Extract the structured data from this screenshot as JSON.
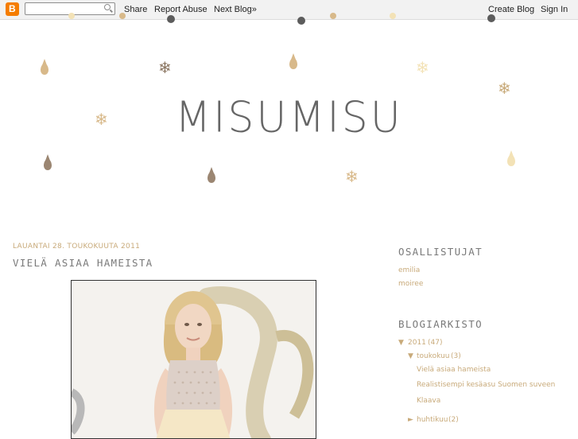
{
  "navbar": {
    "logo_letter": "B",
    "share": "Share",
    "report": "Report Abuse",
    "next": "Next Blog»",
    "create": "Create Blog",
    "signin": "Sign In"
  },
  "header": {
    "title": "MISUMISU"
  },
  "post": {
    "date": "LAUANTAI 28. TOUKOKUUTA 2011",
    "title": "VIELÄ ASIAA HAMEISTA"
  },
  "sidebar": {
    "contributors_heading": "OSALLISTUJAT",
    "contributors": [
      "emilia",
      "moiree"
    ],
    "archive_heading": "BLOGIARKISTO",
    "archive": {
      "year": "2011",
      "year_count": "(47)",
      "month": "toukokuu",
      "month_count": "(3)",
      "posts": [
        "Vielä asiaa hameista",
        "Realistisempi kesäasu Suomen suveen",
        "Klaava"
      ],
      "next_month": "huhtikuu",
      "next_month_count": "(2)"
    }
  },
  "colors": {
    "accent": "#c8aa7a",
    "orange_logo": "#f57d00",
    "drop_brown": "#9b8672",
    "drop_tan": "#d8b98a",
    "drop_gray": "#5c5c5c",
    "drop_pale": "#f3e2b6"
  },
  "icons": [
    "blogger-logo-icon",
    "search-icon",
    "snowflake-icon",
    "raindrop-icon",
    "triangle-down-icon",
    "triangle-right-icon"
  ]
}
